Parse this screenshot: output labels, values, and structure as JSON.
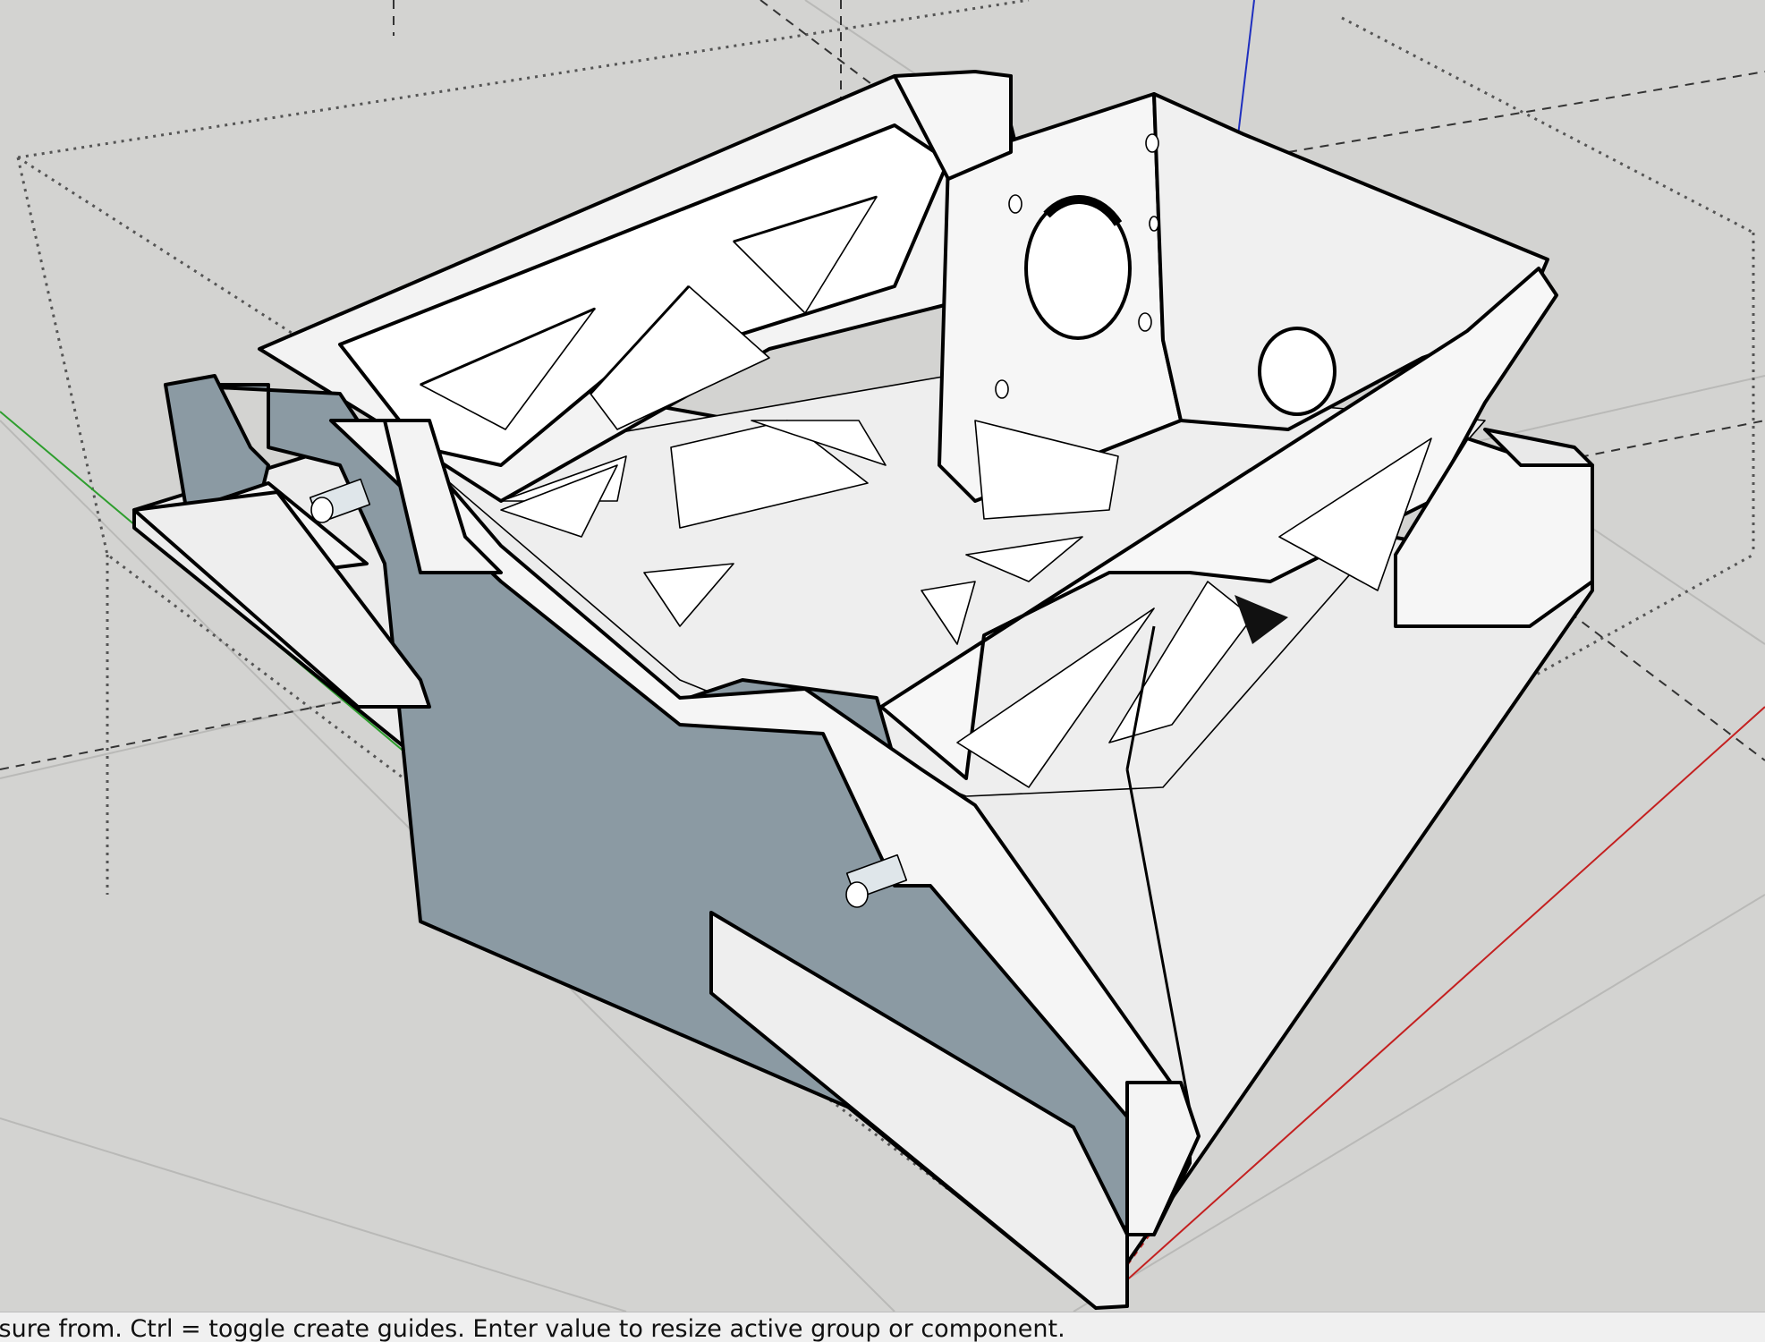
{
  "status_bar": {
    "hint": "asure from.  Ctrl = toggle create guides.  Enter value to resize active group or component."
  },
  "viewport": {
    "background": "#d3d3d1",
    "axes": {
      "red": "#c42020",
      "green": "#2e9e2e",
      "blue": "#1f2fbf"
    },
    "model_face_color": "#f2f2f2",
    "model_back_face_color": "#8b9aa3"
  }
}
